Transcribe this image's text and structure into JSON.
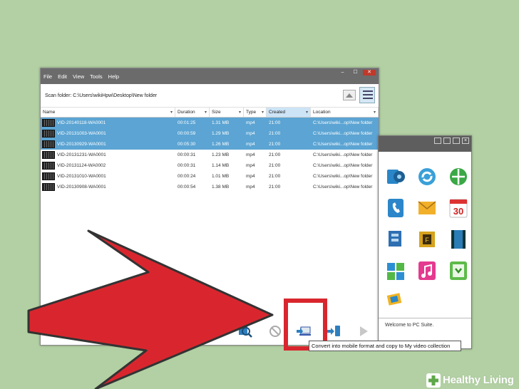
{
  "menu": [
    "File",
    "Edit",
    "View",
    "Tools",
    "Help"
  ],
  "scan_folder": "Scan folder: C:\\Users\\wikiHpw\\Desktop\\New folder",
  "columns": [
    "Name",
    "Duration",
    "Size",
    "Type",
    "Created",
    "Location"
  ],
  "rows": [
    {
      "name": "VID-20140118-WA0001",
      "duration": "00:01:25",
      "size": "1.31 MB",
      "type": "mp4",
      "created": "21:00",
      "location": "C:\\Users\\wiki...op\\New folder",
      "selected": true
    },
    {
      "name": "VID-20131003-WA0001",
      "duration": "00:00:59",
      "size": "1.29 MB",
      "type": "mp4",
      "created": "21:00",
      "location": "C:\\Users\\wiki...op\\New folder",
      "selected": true
    },
    {
      "name": "VID-20130929-WA0001",
      "duration": "00:05:30",
      "size": "1.26 MB",
      "type": "mp4",
      "created": "21:00",
      "location": "C:\\Users\\wiki...op\\New folder",
      "selected": true
    },
    {
      "name": "VID-20131231-WA0001",
      "duration": "00:00:31",
      "size": "1.23 MB",
      "type": "mp4",
      "created": "21:00",
      "location": "C:\\Users\\wiki...op\\New folder",
      "selected": false
    },
    {
      "name": "VID-20131124-WA0002",
      "duration": "00:00:31",
      "size": "1.14 MB",
      "type": "mp4",
      "created": "21:00",
      "location": "C:\\Users\\wiki...op\\New folder",
      "selected": false
    },
    {
      "name": "VID-20131010-WA0001",
      "duration": "00:00:24",
      "size": "1.01 MB",
      "type": "mp4",
      "created": "21:00",
      "location": "C:\\Users\\wiki...op\\New folder",
      "selected": false
    },
    {
      "name": "VID-20130908-WA0001",
      "duration": "00:00:54",
      "size": "1.38 MB",
      "type": "mp4",
      "created": "21:00",
      "location": "C:\\Users\\wiki...op\\New folder",
      "selected": false
    }
  ],
  "side_panel": {
    "welcome": "Welcome to PC Suite."
  },
  "calendar_icon_text": "30",
  "tooltip": "Convert into mobile format and copy to My video collection",
  "watermark": "Healthy Living",
  "colors": {
    "background": "#b2d0a3",
    "selection": "#5ba4d3",
    "arrow": "#d9262e",
    "titlebar": "#6b6b6b"
  },
  "icons": [
    "search-video-icon",
    "cancel-icon",
    "convert-to-phone-icon",
    "transfer-icon",
    "play-icon"
  ]
}
